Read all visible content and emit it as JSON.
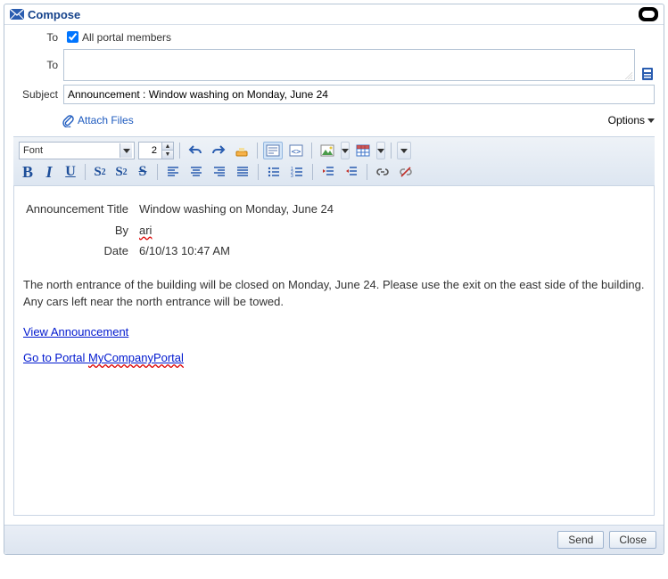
{
  "title": "Compose",
  "fields": {
    "to_label": "To",
    "to2_label": "To",
    "all_portal_members": "All portal members",
    "all_portal_members_checked": true,
    "subject_label": "Subject",
    "subject_value": "Announcement : Window washing on Monday, June 24"
  },
  "actions": {
    "attach_files": "Attach Files",
    "options": "Options",
    "send": "Send",
    "close": "Close"
  },
  "toolbar": {
    "font_label": "Font",
    "font_size": "2"
  },
  "body": {
    "meta": {
      "title_label": "Announcement Title",
      "title_value": "Window washing on Monday, June 24",
      "by_label": "By",
      "by_value": "ari",
      "date_label": "Date",
      "date_value": "6/10/13 10:47 AM"
    },
    "text": "The north entrance of the building will be closed on Monday, June 24. Please use the exit on the east side of the building. Any cars left near the north entrance will be towed.",
    "link_view": "View Announcement",
    "link_portal_prefix": "Go to Portal ",
    "link_portal_name": "MyCompanyPortal"
  }
}
